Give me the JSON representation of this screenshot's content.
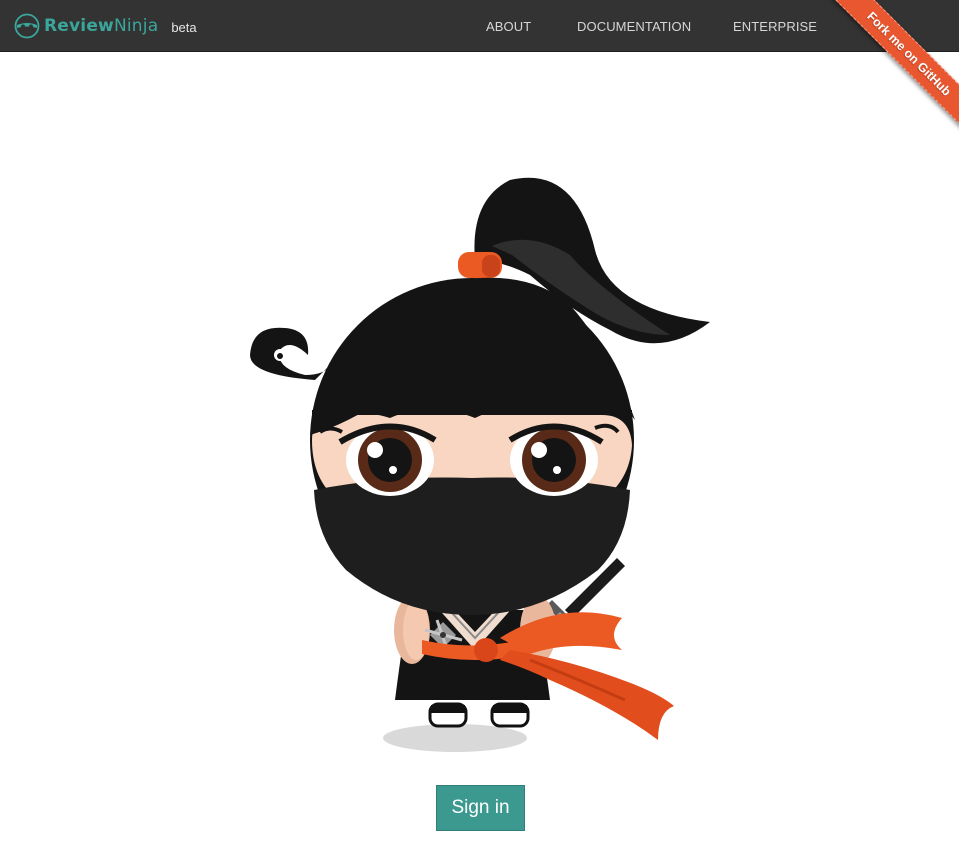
{
  "header": {
    "brand": {
      "name_bold": "Review",
      "name_light": "Ninja",
      "tag": "beta",
      "logo_icon": "ninja-eyes-icon"
    },
    "nav": [
      {
        "label": "ABOUT"
      },
      {
        "label": "DOCUMENTATION"
      },
      {
        "label": "ENTERPRISE"
      }
    ],
    "ribbon": {
      "label": "Fork me on GitHub"
    }
  },
  "main": {
    "illustration": "ninja-mascot",
    "signin_label": "Sign in"
  },
  "colors": {
    "navbar_bg": "#333333",
    "brand_teal": "#3aa69c",
    "button_teal": "#3c9990",
    "ribbon_orange": "#e8572f",
    "ninja_black": "#141414",
    "ninja_skin": "#f8d6c1",
    "scarf_orange": "#ec5a24"
  }
}
